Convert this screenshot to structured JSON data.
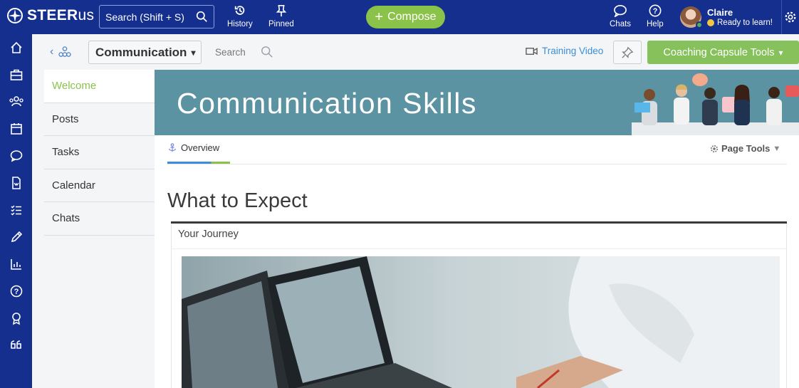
{
  "topbar": {
    "logo_main": "STEER",
    "logo_suffix": "us",
    "search_placeholder": "Search (Shift + S)",
    "history_label": "History",
    "pinned_label": "Pinned",
    "compose_label": "Compose",
    "chats_label": "Chats",
    "help_label": "Help",
    "user_name": "Claire",
    "user_status": "Ready to learn!"
  },
  "rail": {
    "icons": [
      "home-icon",
      "briefcase-icon",
      "people-icon",
      "calendar-icon",
      "chat-icon",
      "document-icon",
      "checklist-icon",
      "pencil-icon",
      "chart-icon",
      "help-icon",
      "award-icon",
      "quote-icon"
    ]
  },
  "subbar": {
    "group_select": "Communication",
    "search_label": "Search",
    "training_video": "Training Video",
    "coaching_tools": "Coaching Capsule Tools"
  },
  "menu": {
    "items": [
      {
        "label": "Welcome",
        "active": true
      },
      {
        "label": "Posts",
        "active": false
      },
      {
        "label": "Tasks",
        "active": false
      },
      {
        "label": "Calendar",
        "active": false
      },
      {
        "label": "Chats",
        "active": false
      }
    ]
  },
  "banner": {
    "title": "Communication Skills"
  },
  "page": {
    "tab_overview": "Overview",
    "page_tools": "Page Tools",
    "heading": "What to Expect",
    "section_label": "Your Journey"
  },
  "colors": {
    "nav_blue": "#152f8f",
    "accent_green": "#8bc34a",
    "banner_teal": "#5b93a3",
    "link_blue": "#3a8ed6"
  }
}
